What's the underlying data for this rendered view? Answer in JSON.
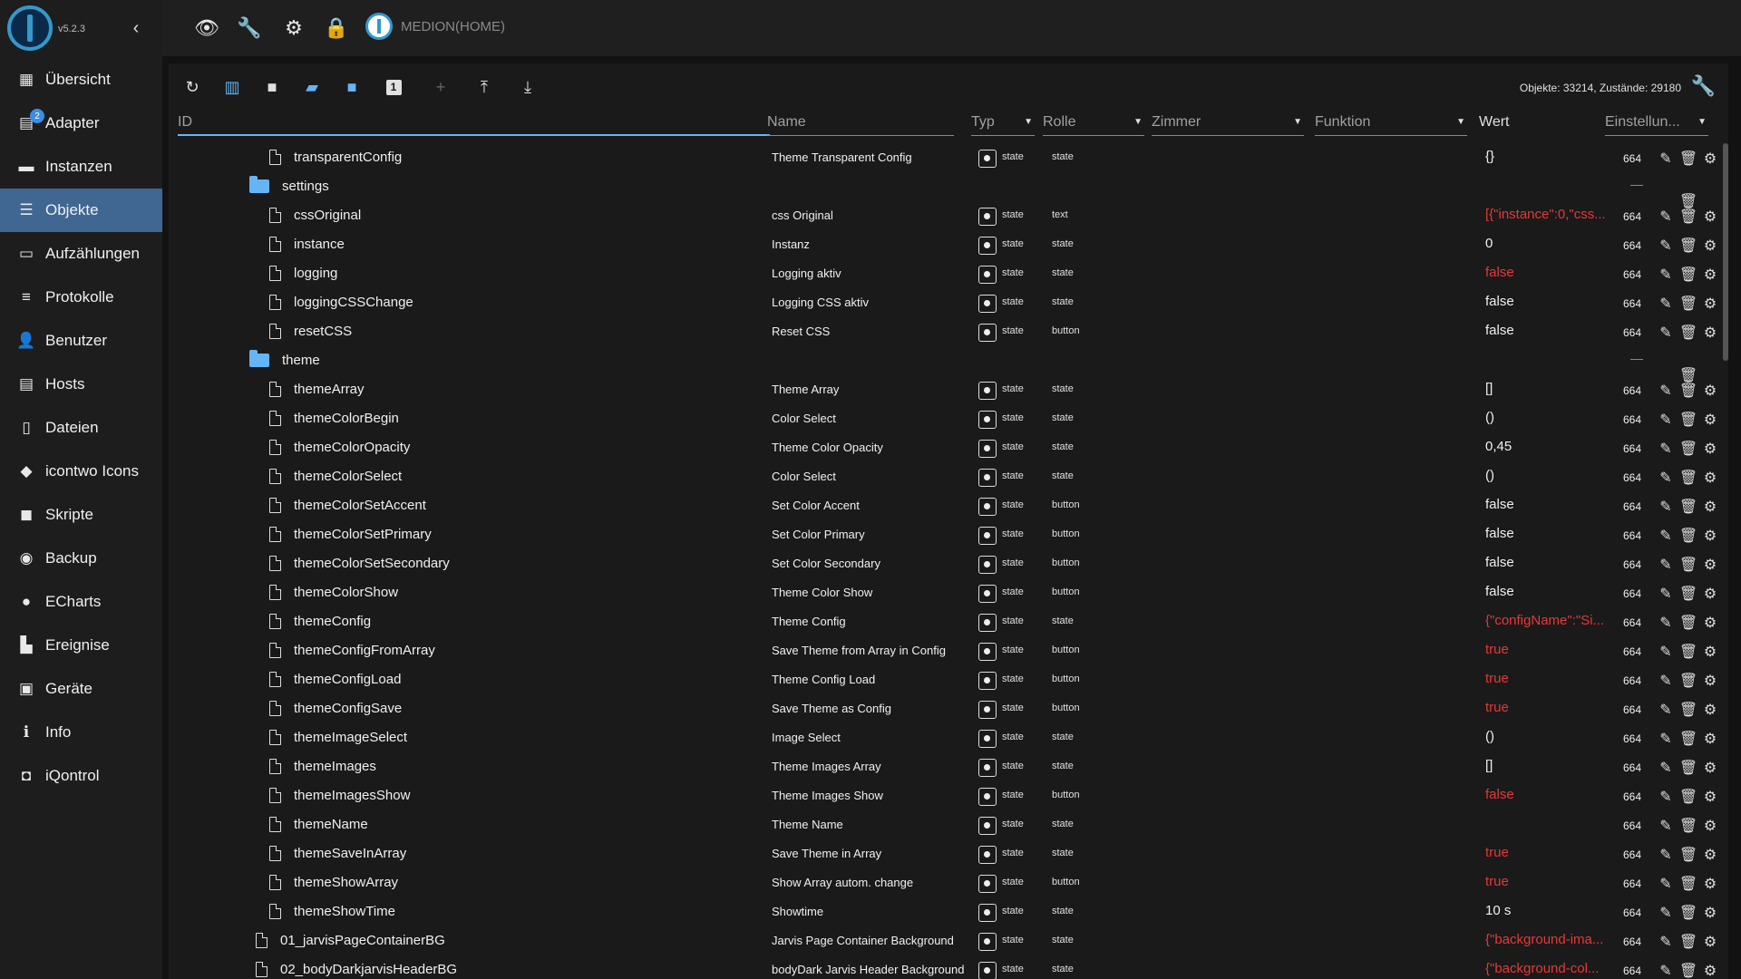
{
  "sidebar": {
    "version": "v5.2.3",
    "items": [
      {
        "label": "Übersicht",
        "icon": "grid-icon",
        "glyph": "▦"
      },
      {
        "label": "Adapter",
        "icon": "adapter-icon",
        "glyph": "▤",
        "badge": "2"
      },
      {
        "label": "Instanzen",
        "icon": "instances-icon",
        "glyph": "▬"
      },
      {
        "label": "Objekte",
        "icon": "list-icon",
        "glyph": "☰",
        "active": true
      },
      {
        "label": "Aufzählungen",
        "icon": "enum-icon",
        "glyph": "▭"
      },
      {
        "label": "Protokolle",
        "icon": "log-icon",
        "glyph": "≡"
      },
      {
        "label": "Benutzer",
        "icon": "user-icon",
        "glyph": "👤"
      },
      {
        "label": "Hosts",
        "icon": "hosts-icon",
        "glyph": "▤"
      },
      {
        "label": "Dateien",
        "icon": "files-icon",
        "glyph": "▯"
      },
      {
        "label": "icontwo Icons",
        "icon": "icontwo-icon",
        "glyph": "◆"
      },
      {
        "label": "Skripte",
        "icon": "scripts-icon",
        "glyph": "◼"
      },
      {
        "label": "Backup",
        "icon": "backup-icon",
        "glyph": "◉"
      },
      {
        "label": "ECharts",
        "icon": "echarts-icon",
        "glyph": "●"
      },
      {
        "label": "Ereignise",
        "icon": "events-icon",
        "glyph": "▙"
      },
      {
        "label": "Geräte",
        "icon": "devices-icon",
        "glyph": "▣"
      },
      {
        "label": "Info",
        "icon": "info-icon",
        "glyph": "ℹ"
      },
      {
        "label": "iQontrol",
        "icon": "iqontrol-icon",
        "glyph": "◘"
      }
    ]
  },
  "topbar": {
    "host_name": "MEDION(HOME)",
    "icons": [
      "eye-icon",
      "wrench-icon",
      "gear-icon",
      "key-icon"
    ]
  },
  "toolbar": {
    "counts": "Objekte: 33214, Zustände: 29180",
    "icons": [
      "refresh-icon",
      "columns-icon",
      "folder-closed-icon",
      "folder-open-icon",
      "folder-blue-icon",
      "number-one-icon",
      "add-icon",
      "upload-icon",
      "download-icon"
    ],
    "number_glyph": "1"
  },
  "columns": {
    "id": "ID",
    "name": "Name",
    "type": "Typ",
    "role": "Rolle",
    "room": "Zimmer",
    "function": "Funktion",
    "value": "Wert",
    "settings": "Einstellun..."
  },
  "colors": {
    "accent": "#3f6792",
    "blue": "#64b5f6",
    "red": "#e53935"
  },
  "rows": [
    {
      "kind": "file",
      "level": 2,
      "id": "transparentConfig",
      "name": "Theme Transparent Config",
      "type": "state",
      "role": "state",
      "value": "{}",
      "red": false,
      "acl": "664"
    },
    {
      "kind": "folder",
      "level": 1,
      "id": "settings"
    },
    {
      "kind": "file",
      "level": 2,
      "id": "cssOriginal",
      "name": "css Original",
      "type": "state",
      "role": "text",
      "value": "[{\"instance\":0,\"css...",
      "red": true,
      "acl": "664"
    },
    {
      "kind": "file",
      "level": 2,
      "id": "instance",
      "name": "Instanz",
      "type": "state",
      "role": "state",
      "value": "0",
      "red": false,
      "acl": "664"
    },
    {
      "kind": "file",
      "level": 2,
      "id": "logging",
      "name": "Logging aktiv",
      "type": "state",
      "role": "state",
      "value": "false",
      "red": true,
      "acl": "664"
    },
    {
      "kind": "file",
      "level": 2,
      "id": "loggingCSSChange",
      "name": "Logging CSS aktiv",
      "type": "state",
      "role": "state",
      "value": "false",
      "red": false,
      "acl": "664"
    },
    {
      "kind": "file",
      "level": 2,
      "id": "resetCSS",
      "name": "Reset CSS",
      "type": "state",
      "role": "button",
      "value": "false",
      "red": false,
      "acl": "664"
    },
    {
      "kind": "folder",
      "level": 1,
      "id": "theme"
    },
    {
      "kind": "file",
      "level": 2,
      "id": "themeArray",
      "name": "Theme Array",
      "type": "state",
      "role": "state",
      "value": "[]",
      "red": false,
      "acl": "664"
    },
    {
      "kind": "file",
      "level": 2,
      "id": "themeColorBegin",
      "name": "Color Select",
      "type": "state",
      "role": "state",
      "value": "()",
      "red": false,
      "acl": "664"
    },
    {
      "kind": "file",
      "level": 2,
      "id": "themeColorOpacity",
      "name": "Theme Color Opacity",
      "type": "state",
      "role": "state",
      "value": "0,45",
      "red": false,
      "acl": "664"
    },
    {
      "kind": "file",
      "level": 2,
      "id": "themeColorSelect",
      "name": "Color Select",
      "type": "state",
      "role": "state",
      "value": "()",
      "red": false,
      "acl": "664"
    },
    {
      "kind": "file",
      "level": 2,
      "id": "themeColorSetAccent",
      "name": "Set Color Accent",
      "type": "state",
      "role": "button",
      "value": "false",
      "red": false,
      "acl": "664"
    },
    {
      "kind": "file",
      "level": 2,
      "id": "themeColorSetPrimary",
      "name": "Set Color Primary",
      "type": "state",
      "role": "button",
      "value": "false",
      "red": false,
      "acl": "664"
    },
    {
      "kind": "file",
      "level": 2,
      "id": "themeColorSetSecondary",
      "name": "Set Color Secondary",
      "type": "state",
      "role": "button",
      "value": "false",
      "red": false,
      "acl": "664"
    },
    {
      "kind": "file",
      "level": 2,
      "id": "themeColorShow",
      "name": "Theme Color Show",
      "type": "state",
      "role": "button",
      "value": "false",
      "red": false,
      "acl": "664"
    },
    {
      "kind": "file",
      "level": 2,
      "id": "themeConfig",
      "name": "Theme Config",
      "type": "state",
      "role": "state",
      "value": "{\"configName\":\"Si...",
      "red": true,
      "acl": "664"
    },
    {
      "kind": "file",
      "level": 2,
      "id": "themeConfigFromArray",
      "name": "Save Theme from Array in Config",
      "type": "state",
      "role": "button",
      "value": "true",
      "red": true,
      "acl": "664"
    },
    {
      "kind": "file",
      "level": 2,
      "id": "themeConfigLoad",
      "name": "Theme Config Load",
      "type": "state",
      "role": "button",
      "value": "true",
      "red": true,
      "acl": "664"
    },
    {
      "kind": "file",
      "level": 2,
      "id": "themeConfigSave",
      "name": "Save Theme as Config",
      "type": "state",
      "role": "button",
      "value": "true",
      "red": true,
      "acl": "664"
    },
    {
      "kind": "file",
      "level": 2,
      "id": "themeImageSelect",
      "name": "Image Select",
      "type": "state",
      "role": "state",
      "value": "()",
      "red": false,
      "acl": "664"
    },
    {
      "kind": "file",
      "level": 2,
      "id": "themeImages",
      "name": "Theme Images Array",
      "type": "state",
      "role": "state",
      "value": "[]",
      "red": false,
      "acl": "664"
    },
    {
      "kind": "file",
      "level": 2,
      "id": "themeImagesShow",
      "name": "Theme Images Show",
      "type": "state",
      "role": "button",
      "value": "false",
      "red": true,
      "acl": "664"
    },
    {
      "kind": "file",
      "level": 2,
      "id": "themeName",
      "name": "Theme Name",
      "type": "state",
      "role": "state",
      "value": "",
      "red": false,
      "acl": "664"
    },
    {
      "kind": "file",
      "level": 2,
      "id": "themeSaveInArray",
      "name": "Save Theme in Array",
      "type": "state",
      "role": "state",
      "value": "true",
      "red": true,
      "acl": "664"
    },
    {
      "kind": "file",
      "level": 2,
      "id": "themeShowArray",
      "name": "Show Array autom. change",
      "type": "state",
      "role": "button",
      "value": "true",
      "red": true,
      "acl": "664"
    },
    {
      "kind": "file",
      "level": 2,
      "id": "themeShowTime",
      "name": "Showtime",
      "type": "state",
      "role": "state",
      "value": "10 s",
      "red": false,
      "acl": "664"
    },
    {
      "kind": "file",
      "level": 1,
      "id": "01_jarvisPageContainerBG",
      "name": "Jarvis Page Container Background",
      "type": "state",
      "role": "state",
      "value": "{\"background-ima...",
      "red": true,
      "acl": "664"
    },
    {
      "kind": "file",
      "level": 1,
      "id": "02_bodyDarkjarvisHeaderBG",
      "name": "bodyDark Jarvis Header Background",
      "type": "state",
      "role": "state",
      "value": "{\"background-col...",
      "red": true,
      "acl": "664"
    }
  ]
}
